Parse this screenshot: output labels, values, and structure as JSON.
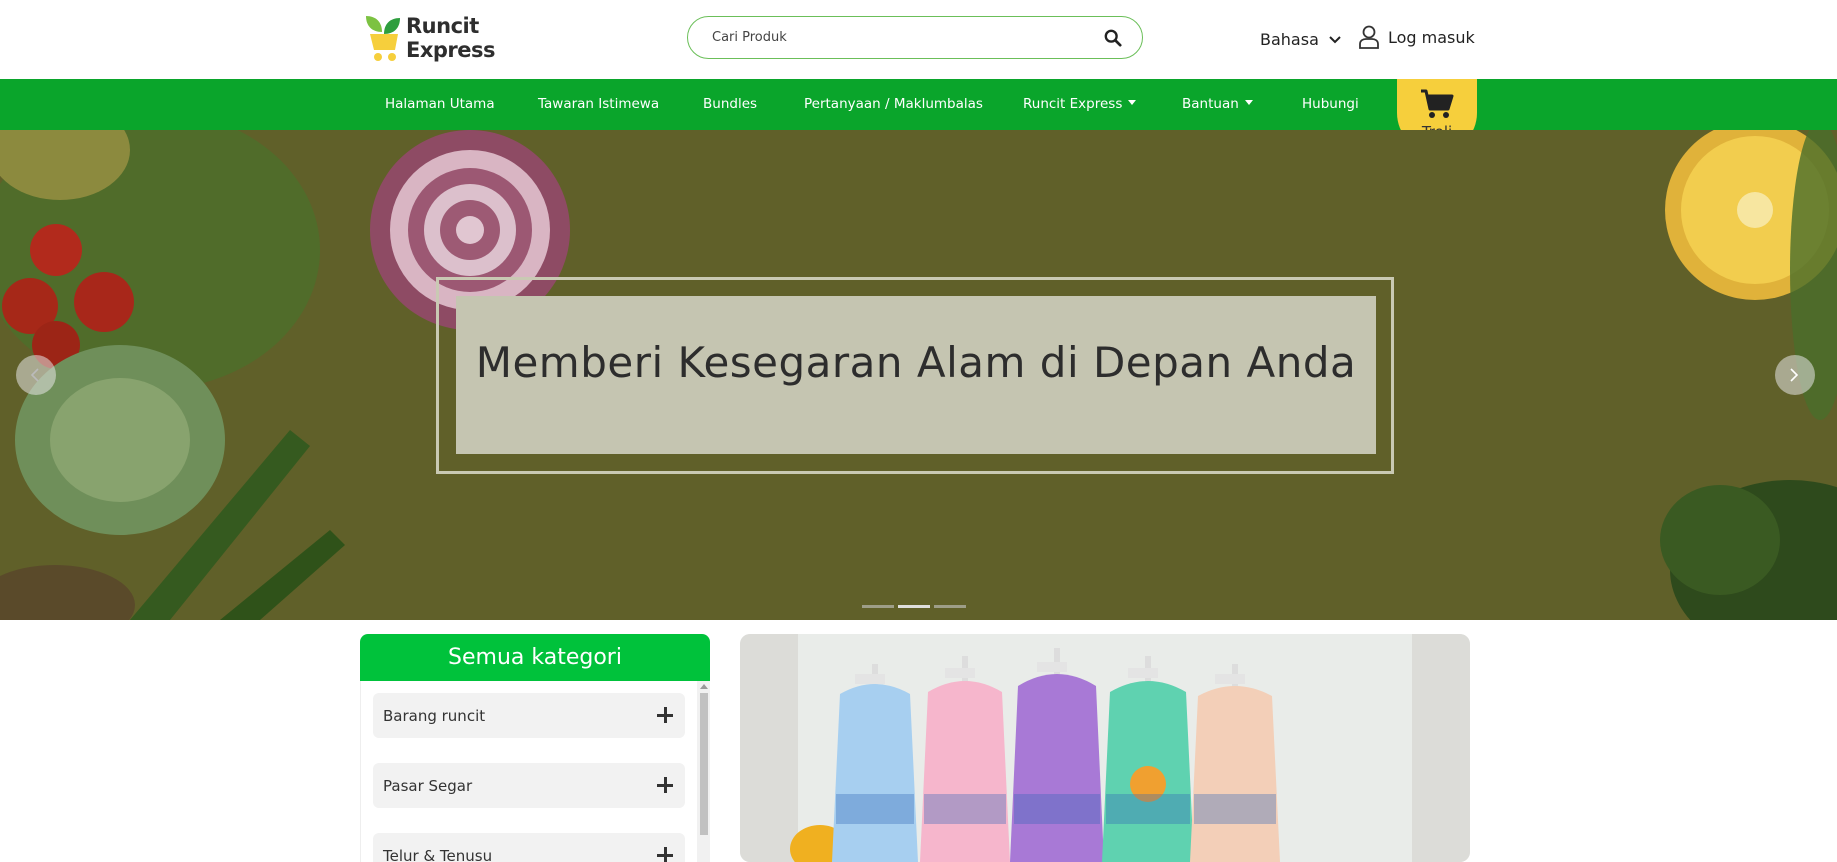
{
  "brand": {
    "line1": "Runcit",
    "line2": "Express",
    "green": "#0aa52b",
    "yellow": "#f6cf3c"
  },
  "search": {
    "placeholder": "Cari Produk",
    "icon": "search-icon"
  },
  "header": {
    "language_label": "Bahasa",
    "login_label": "Log masuk"
  },
  "nav": {
    "items": [
      {
        "label": "Halaman Utama"
      },
      {
        "label": "Tawaran Istimewa"
      },
      {
        "label": "Bundles"
      },
      {
        "label": "Pertanyaan / Maklumbalas"
      },
      {
        "label": "Runcit Express"
      },
      {
        "label": "Bantuan"
      },
      {
        "label": "Hubungi"
      }
    ],
    "cart_label": "Troli"
  },
  "hero": {
    "title": "Memberi Kesegaran Alam di Depan Anda",
    "slides_total": 3,
    "active_slide": 2
  },
  "categories": {
    "title": "Semua kategori",
    "items": [
      {
        "label": "Barang runcit"
      },
      {
        "label": "Pasar Segar"
      },
      {
        "label": "Telur & Tenusu"
      }
    ]
  }
}
